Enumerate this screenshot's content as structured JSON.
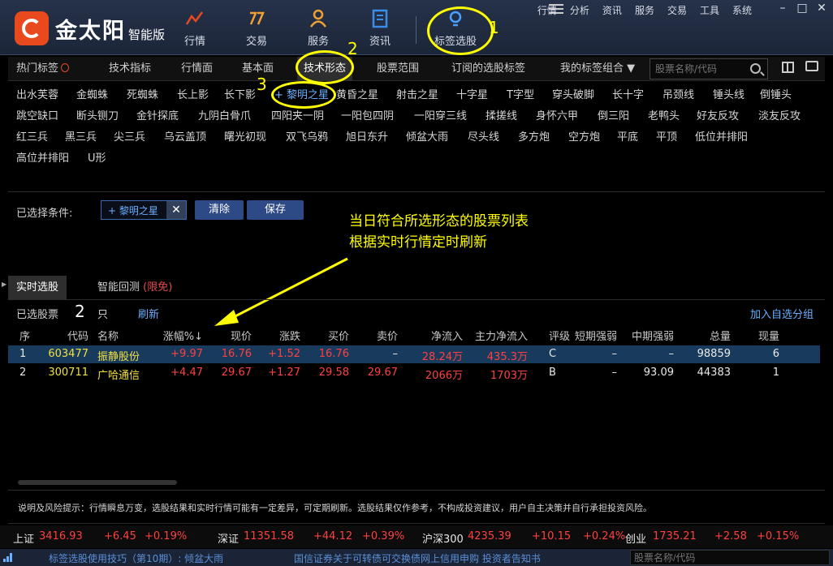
{
  "app": {
    "brand": "金太阳",
    "edition": "智能版"
  },
  "top_nav": [
    {
      "label": "行情",
      "icon": "chart-line-icon"
    },
    {
      "label": "交易",
      "icon": "trade-icon"
    },
    {
      "label": "服务",
      "icon": "user-icon"
    },
    {
      "label": "资讯",
      "icon": "news-icon"
    },
    {
      "label": "标签选股",
      "icon": "lightbulb-icon"
    }
  ],
  "menu": [
    "行情",
    "分析",
    "资讯",
    "服务",
    "交易",
    "工具",
    "系统"
  ],
  "window_controls": [
    "–",
    "□",
    "✕"
  ],
  "tabs": {
    "hot": "热门标签",
    "items": [
      "技术指标",
      "行情面",
      "基本面",
      "技术形态",
      "股票范围",
      "订阅的选股标签",
      "我的标签组合"
    ],
    "dropdown_arrow": "▼",
    "search_placeholder": "股票名称/代码"
  },
  "patterns": [
    [
      "出水芙蓉",
      "金蜘蛛",
      "死蜘蛛",
      "长上影",
      "长下影",
      "+ 黎明之星",
      "黄昏之星",
      "射击之星",
      "十字星",
      "T字型",
      "穿头破脚",
      "长十字",
      "吊颈线",
      "锤头线",
      "倒锤头"
    ],
    [
      "跳空缺口",
      "断头铡刀",
      "金针探底",
      "九阴白骨爪",
      "四阳夹一阴",
      "一阳包四阴",
      "一阳穿三线",
      "揉搓线",
      "身怀六甲",
      "倒三阳",
      "老鸭头",
      "好友反攻",
      "淡友反攻"
    ],
    [
      "红三兵",
      "黑三兵",
      "尖三兵",
      "乌云盖顶",
      "曙光初现",
      "双飞乌鸦",
      "旭日东升",
      "倾盆大雨",
      "尽头线",
      "多方炮",
      "空方炮",
      "平底",
      "平顶",
      "低位并排阳"
    ],
    [
      "高位并排阳",
      "U形"
    ]
  ],
  "selected_pattern": "+ 黎明之星",
  "conditions": {
    "label": "已选择条件:",
    "chip": "+ 黎明之星",
    "remove": "✕",
    "clear": "清除",
    "save": "保存"
  },
  "annotations": {
    "n1": "1",
    "n2": "2",
    "n3": "3",
    "line1": "当日符合所选形态的股票列表",
    "line2": "根据实时行情定时刷新"
  },
  "results": {
    "tab_realtime": "实时选股",
    "tab_backtest": "智能回测",
    "limited": "(限免)",
    "count_label": "已选股票",
    "count": "2",
    "count_unit": "只",
    "refresh": "刷新",
    "add_group": "加入自选分组"
  },
  "table": {
    "headers": [
      "序",
      "代码",
      "名称",
      "涨幅%↓",
      "现价",
      "涨跌",
      "买价",
      "卖价",
      "净流入",
      "主力净流入",
      "评级",
      "短期强弱",
      "中期强弱",
      "总量",
      "现量"
    ],
    "rows": [
      [
        "1",
        "603477",
        "振静股份",
        "+9.97",
        "16.76",
        "+1.52",
        "16.76",
        "–",
        "28.24万",
        "435.3万",
        "C",
        "–",
        "–",
        "98859",
        "6"
      ],
      [
        "2",
        "300711",
        "广哈通信",
        "+4.47",
        "29.67",
        "+1.27",
        "29.58",
        "29.67",
        "2066万",
        "1703万",
        "B",
        "–",
        "93.09",
        "44383",
        "1"
      ]
    ]
  },
  "disclaimer": "说明及风险提示：行情瞬息万变，选股结果和实时行情可能有一定差异，可定期刷新。选股结果仅作参考，不构成投资建议，用户自主决策并自行承担投资风险。",
  "ticker": [
    {
      "name": "上证",
      "value": "3416.93",
      "change": "+6.45",
      "pct": "+0.19%"
    },
    {
      "name": "深证",
      "value": "11351.58",
      "change": "+44.12",
      "pct": "+0.39%"
    },
    {
      "name": "沪深300",
      "value": "4235.39",
      "change": "+10.15",
      "pct": "+0.24%"
    },
    {
      "name": "创业",
      "value": "1735.21",
      "change": "+2.58",
      "pct": "+0.15%"
    }
  ],
  "status": {
    "link1": "标签选股使用技巧（第10期）: 倾盆大雨",
    "link2": "国信证券关于可转债可交换债网上信用申购 投资者告知书",
    "search_placeholder": "股票名称/代码"
  },
  "colors": {
    "up": "#ff4040",
    "accent": "#6ab0ff",
    "annotation": "#ffff00",
    "brand": "#e8491d"
  }
}
